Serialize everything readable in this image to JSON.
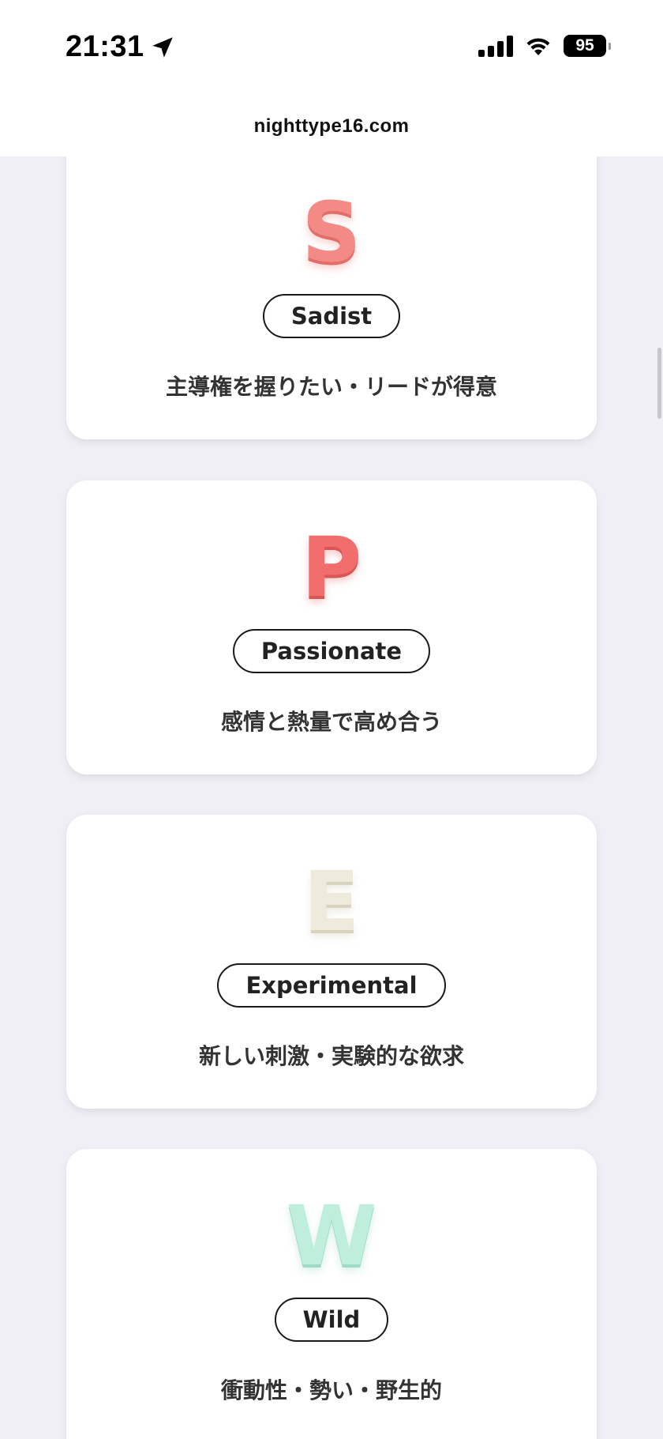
{
  "status_bar": {
    "time": "21:31",
    "battery": "95",
    "icons": [
      "location-arrow-icon",
      "cellular-signal-icon",
      "wifi-icon",
      "battery-icon"
    ]
  },
  "browser": {
    "url": "nighttype16.com"
  },
  "cards": [
    {
      "letter": "S",
      "label": "Sadist",
      "description": "主導権を握りたい・リードが得意",
      "color": "#f48a86"
    },
    {
      "letter": "P",
      "label": "Passionate",
      "description": "感情と熱量で高め合う",
      "color": "#f26e6c"
    },
    {
      "letter": "E",
      "label": "Experimental",
      "description": "新しい刺激・実験的な欲求",
      "color": "#eeeadc"
    },
    {
      "letter": "W",
      "label": "Wild",
      "description": "衝動性・勢い・野生的",
      "color": "#bfeedd"
    }
  ],
  "colors": {
    "background": "#efeff5",
    "card": "#ffffff",
    "text": "#222222"
  }
}
